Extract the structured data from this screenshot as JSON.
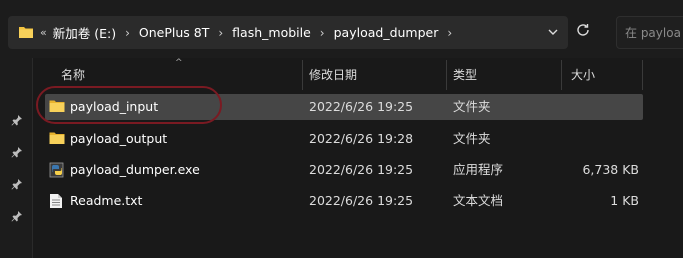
{
  "address_bar": {
    "overflow": "«",
    "crumbs": [
      "新加卷 (E:)",
      "OnePlus 8T",
      "flash_mobile",
      "payload_dumper"
    ]
  },
  "search": {
    "placeholder": "在 payloa"
  },
  "columns": {
    "name": "名称",
    "date": "修改日期",
    "type": "类型",
    "size": "大小"
  },
  "files": [
    {
      "name": "payload_input",
      "date": "2022/6/26 19:25",
      "type": "文件夹",
      "size": "",
      "icon": "folder-icon",
      "selected": true
    },
    {
      "name": "payload_output",
      "date": "2022/6/26 19:28",
      "type": "文件夹",
      "size": "",
      "icon": "folder-icon",
      "selected": false
    },
    {
      "name": "payload_dumper.exe",
      "date": "2022/6/26 19:25",
      "type": "应用程序",
      "size": "6,738 KB",
      "icon": "python-exe-icon",
      "selected": false
    },
    {
      "name": "Readme.txt",
      "date": "2022/6/26 19:25",
      "type": "文本文档",
      "size": "1 KB",
      "icon": "text-file-icon",
      "selected": false
    }
  ],
  "colors": {
    "folder": "#f3c33f",
    "selection": "#464646",
    "annotation": "#7a1a22"
  }
}
